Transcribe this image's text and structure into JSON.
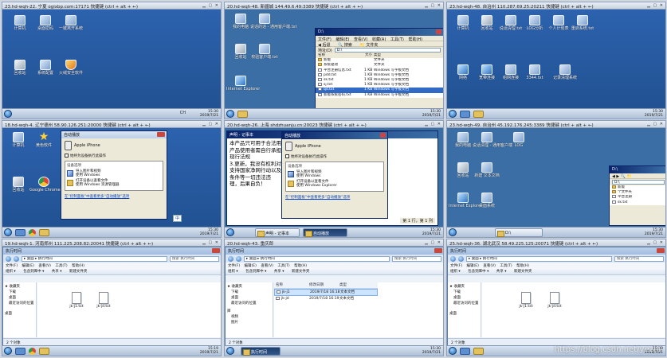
{
  "panes": [
    {
      "title": "23.hd-wqh-22.  宁夏  ogixbp.com:17171  快捷键 (ctrl + alt + ←)",
      "desktop_icons": [
        "计算机",
        "桌面密码",
        "一键离开系统",
        "回收站",
        "系统配置",
        "火绒安全软件"
      ],
      "tray_text": "CH",
      "clock_time": "15:30",
      "clock_date": "2019/7/21"
    },
    {
      "title": "20.hd-wqh-48.  新疆城  144.49.6.49:3389  快捷键 (ctrl + alt + ←)",
      "desktop_icons": [
        "我的电脑",
        "说话的话 - 通用客户端.txt",
        "回收站",
        "校验客户端.txt",
        "Internet Explorer"
      ],
      "explorer": {
        "title": "D:\\",
        "menu": [
          "文件(F)",
          "编辑(E)",
          "查看(V)",
          "收藏(A)",
          "工具(T)",
          "帮助(H)"
        ],
        "toolbar": [
          "后退",
          "搜索",
          "文件夹"
        ],
        "address_label": "地址(D)",
        "address_value": "D:\\",
        "columns": [
          "名称",
          "大小",
          "类型"
        ],
        "files": [
          {
            "name": "新版",
            "size": "",
            "type": "文件夹"
          },
          {
            "name": "系统驱动",
            "size": "",
            "type": "文件夹"
          },
          {
            "name": "平台注册信息.txt",
            "size": "1 KB",
            "type": "Windows 写字板文档"
          },
          {
            "name": "pdd.txt",
            "size": "1 KB",
            "type": "Windows 写字板文档"
          },
          {
            "name": "sk.txt",
            "size": "1 KB",
            "type": "Windows 写字板文档"
          },
          {
            "name": "sj.txt",
            "size": "1 KB",
            "type": "Windows 写字板文档"
          },
          {
            "name": "qd.txt",
            "size": "1 KB",
            "type": "Windows 写字板文档"
          },
          {
            "name": "新版系统密码.txt",
            "size": "1 KB",
            "type": "Windows 写字板文档"
          }
        ]
      },
      "clock_time": "15:30",
      "clock_date": "2019/7/21"
    },
    {
      "title": "23.hd-wqh-48.  自治州  110.287.69.25:20211  快捷键 (ctrl + alt + ←)",
      "desktop_icons": [
        "计算机",
        "回收站",
        "说话清理.txt",
        "LOG分析",
        "个人计划表",
        "重启系统.txt",
        "网络",
        "宽带连接",
        "组网连接",
        "3344.txt",
        "记录清理系统"
      ],
      "clock_time": "15:30",
      "clock_date": "2019/7/21"
    },
    {
      "title": "18.hd-wqh-4.  辽宁德州  58.90.126.251:20000  快捷键 (ctrl + alt + ←)",
      "desktop_icons": [
        "计算机",
        "黄色软件",
        "回收站",
        "Google Chrome"
      ],
      "autoplay": {
        "title": "自动播放",
        "device": "Apple iPhone",
        "always_do": "始终为设备执行此操作",
        "group": "设备选项",
        "options": [
          {
            "label": "导入图片和视频",
            "sub": "使用 Windows"
          },
          {
            "label": "打开设备以查看文件",
            "sub": "使用 Windows 资源管理器"
          }
        ],
        "link": "在“控制面板”中查看更多“自动播放”选项"
      },
      "ime": "中",
      "clock_time": "15:30",
      "clock_date": "2019/7/21"
    },
    {
      "title": "20.hd-wqh-26.  上海  shdzhuanju.cn:20023  快捷键 (ctrl + alt + ←)",
      "notepad": {
        "title": "声明 - 记事本",
        "text": "本产品只可用于合法用途，严禁用于违法活动！\n产品使用者需自行承担\n现行法规\n3.更新，我没有权利对\n支持国家净网行动以及\n条件等一切违法违\n理，后果自负！",
        "status": "第 1 行，第 1 列"
      },
      "autoplay": {
        "title": "自动播放",
        "device": "Apple iPhone",
        "always_do": "始终对设备执行此操作",
        "group": "设备选项",
        "options": [
          {
            "label": "导入图片和视频",
            "sub": "使用 Windows"
          },
          {
            "label": "打开设备以查看文件",
            "sub": "使用 Windows Explorer"
          }
        ],
        "link": "在“控制面板”中查看更多“自动播放”选项"
      },
      "tasks": [
        "声明 - 记事本",
        "自动播放"
      ],
      "clock_time": "15:30",
      "clock_date": "2019/7/21"
    },
    {
      "title": "23.hd-wqh-49.  自治州  45.192.176.245:3389  快捷键 (ctrl + alt + ←)",
      "desktop_icons": [
        "我的电脑",
        "说话清理 - 通用客户端",
        "LOG",
        "回收站",
        "新建 文本文档",
        "Internet Explorer",
        "桌面系统"
      ],
      "explorer": {
        "title": "D:\\",
        "address_value": "D:\\",
        "files": [
          "新版",
          "个文件夹",
          "平台注册",
          "sk.txt"
        ]
      },
      "clock_time": "15:30",
      "clock_date": "2019/7/21"
    },
    {
      "title": "19.hd-wqh-1.  河南郑州  111.225.208.82:20041  快捷键 (ctrl + alt + ←)",
      "explorer7": {
        "title": "执行时间",
        "path": "▸ 桌面 ▸ 执行时间",
        "search": "搜索 执行时间",
        "menu": [
          "文件(F)",
          "编辑(E)",
          "查看(V)",
          "工具(T)",
          "帮助(H)"
        ],
        "tools": [
          "组织 ▾",
          "包含到库中 ▾",
          "共享 ▾",
          "新建文件夹"
        ],
        "nav": [
          "收藏夹",
          "下载",
          "桌面",
          "最近访问的位置",
          "桌面"
        ],
        "files": [
          "jk-j1.txt",
          "jk-jd.txt"
        ],
        "status": "2 个对象"
      },
      "clock_time": "15:19",
      "clock_date": "2019/7/21"
    },
    {
      "title": "20.hd-wqh-43.  重庆郎",
      "explorer7": {
        "title": "执行时间",
        "path": "▸ 桌面 ▸ 执行时间",
        "search": "搜索 执行时间",
        "menu": [
          "文件(F)",
          "编辑(E)",
          "查看(V)",
          "工具(T)",
          "帮助(H)"
        ],
        "tools": [
          "组织 ▾",
          "包含到库中 ▾",
          "共享 ▾",
          "新建文件夹"
        ],
        "nav": [
          "收藏夹",
          "下载",
          "桌面",
          "最近访问的位置",
          "库",
          "视频",
          "图片"
        ],
        "columns": [
          "名称",
          "修改日期",
          "类型"
        ],
        "rows": [
          {
            "name": "jk-j1",
            "date": "2019/7/18 16:18",
            "type": "文本文档"
          },
          {
            "name": "jk-jd",
            "date": "2019/7/18 16:19",
            "type": "文本文档"
          }
        ],
        "status": "2 个对象"
      },
      "tasks": [
        "执行时间"
      ],
      "clock_time": "15:30",
      "clock_date": "2019/7/21"
    },
    {
      "title": "25.hd-wqh-36.  湖北武汉  58.49.225.125:20071  快捷键 (ctrl + alt + ←)",
      "explorer7": {
        "title": "执行时间",
        "path": "▸ 桌面 ▸ 执行时间",
        "search": "搜索 执行时间",
        "menu": [
          "文件(F)",
          "编辑(E)",
          "查看(V)",
          "工具(T)",
          "帮助(H)"
        ],
        "tools": [
          "组织 ▾",
          "包含到库中 ▾",
          "共享 ▾",
          "新建文件夹"
        ],
        "nav": [
          "收藏夹",
          "下载",
          "桌面",
          "最近访问的位置",
          "桌面"
        ],
        "files": [
          "jk-j1.txt",
          "jk-jd.txt"
        ],
        "status": "2 个对象"
      },
      "clock_time": "15:30",
      "clock_date": "2019/7/21"
    }
  ],
  "watermark": "https://blog.csdn.net/yezhi"
}
